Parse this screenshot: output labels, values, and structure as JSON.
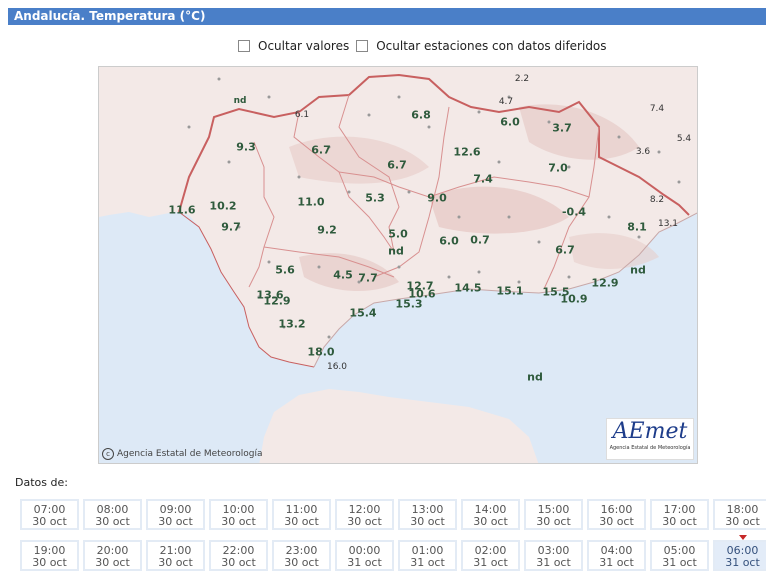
{
  "header": {
    "title": "Andalucía. Temperatura (°C)"
  },
  "options": {
    "hide_values": "Ocultar valores",
    "hide_stations": "Ocultar estaciones con datos diferidos"
  },
  "map": {
    "credit": "Agencia Estatal de Meteorología",
    "logo_name": "AEmet",
    "logo_sub": "Agencia Estatal de Meteorología",
    "labels": {
      "l0": "nd",
      "l1": "6.1",
      "l2": "9.3",
      "l3": "6.7",
      "l4": "6.8",
      "l5": "2.2",
      "l6": "4.7",
      "l7": "6.0",
      "l8": "3.7",
      "l9": "7.4",
      "l10": "5.4",
      "l11": "3.6",
      "l12": "12.6",
      "l13": "6.7",
      "l14": "7.0",
      "l15": "7.4",
      "l16": "8.2",
      "l17": "11.6",
      "l18": "10.2",
      "l19": "11.0",
      "l20": "5.3",
      "l21": "9.0",
      "l22": "-0.4",
      "l23": "8.1",
      "l24": "13.1",
      "l25": "9.7",
      "l26": "9.2",
      "l27": "5.0",
      "l28": "nd",
      "l29": "6.0",
      "l30": "0.7",
      "l31": "6.7",
      "l32": "5.6",
      "l33": "4.5",
      "l34": "7.7",
      "l35": "nd",
      "l36": "12.7",
      "l37": "10.6",
      "l38": "14.5",
      "l39": "15.1",
      "l40": "15.5",
      "l41": "12.9",
      "l42": "13.6",
      "l43": "12.9",
      "l44": "15.3",
      "l45": "10.9",
      "l46": "15.4",
      "l47": "13.2",
      "l48": "18.0",
      "l49": "16.0",
      "l50": "nd"
    }
  },
  "datos_label": "Datos de:",
  "times": [
    {
      "time": "07:00",
      "date": "30 oct"
    },
    {
      "time": "08:00",
      "date": "30 oct"
    },
    {
      "time": "09:00",
      "date": "30 oct"
    },
    {
      "time": "10:00",
      "date": "30 oct"
    },
    {
      "time": "11:00",
      "date": "30 oct"
    },
    {
      "time": "12:00",
      "date": "30 oct"
    },
    {
      "time": "13:00",
      "date": "30 oct"
    },
    {
      "time": "14:00",
      "date": "30 oct"
    },
    {
      "time": "15:00",
      "date": "30 oct"
    },
    {
      "time": "16:00",
      "date": "30 oct"
    },
    {
      "time": "17:00",
      "date": "30 oct"
    },
    {
      "time": "18:00",
      "date": "30 oct"
    },
    {
      "time": "19:00",
      "date": "30 oct"
    },
    {
      "time": "20:00",
      "date": "30 oct"
    },
    {
      "time": "21:00",
      "date": "30 oct"
    },
    {
      "time": "22:00",
      "date": "30 oct"
    },
    {
      "time": "23:00",
      "date": "30 oct"
    },
    {
      "time": "00:00",
      "date": "31 oct"
    },
    {
      "time": "01:00",
      "date": "31 oct"
    },
    {
      "time": "02:00",
      "date": "31 oct"
    },
    {
      "time": "03:00",
      "date": "31 oct"
    },
    {
      "time": "04:00",
      "date": "31 oct"
    },
    {
      "time": "05:00",
      "date": "31 oct"
    },
    {
      "time": "06:00",
      "date": "31 oct"
    }
  ],
  "selected_index": 23,
  "colors": {
    "header": "#4a7fc8",
    "sea": "#dde9f6",
    "land": "#f2e8e6",
    "border": "#c86060",
    "value_text": "#2e5a3c"
  }
}
